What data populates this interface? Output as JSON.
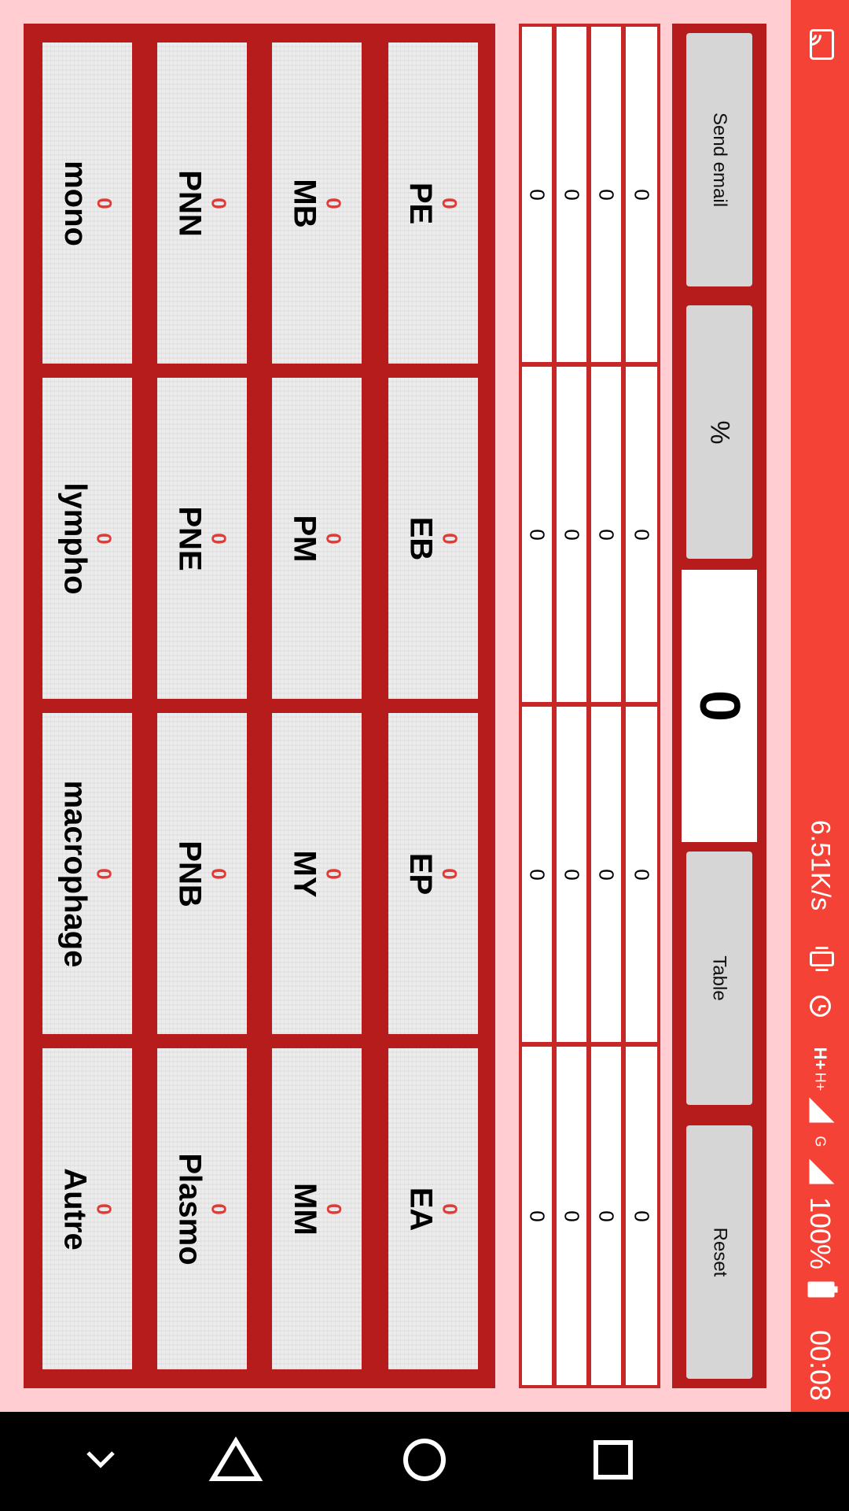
{
  "status_bar": {
    "net_speed": "6.51K/s",
    "network_primary": "H+",
    "network_secondary": "H+",
    "network_tertiary": "G",
    "battery": "100%",
    "time": "00:08",
    "icons": [
      "cast-icon",
      "vibrate-icon",
      "alarm-icon",
      "signal-icon",
      "signal-icon",
      "battery-icon"
    ]
  },
  "controls": {
    "send_email": "Send email",
    "percent": "%",
    "counter": "0",
    "table": "Table",
    "reset": "Reset"
  },
  "table": {
    "rows": [
      [
        "0",
        "0",
        "0",
        "0"
      ],
      [
        "0",
        "0",
        "0",
        "0"
      ],
      [
        "0",
        "0",
        "0",
        "0"
      ],
      [
        "0",
        "0",
        "0",
        "0"
      ]
    ]
  },
  "grid": {
    "rows": [
      [
        {
          "label": "PE",
          "count": "0"
        },
        {
          "label": "EB",
          "count": "0"
        },
        {
          "label": "EP",
          "count": "0"
        },
        {
          "label": "EA",
          "count": "0"
        }
      ],
      [
        {
          "label": "MB",
          "count": "0"
        },
        {
          "label": "PM",
          "count": "0"
        },
        {
          "label": "MY",
          "count": "0"
        },
        {
          "label": "MM",
          "count": "0"
        }
      ],
      [
        {
          "label": "PNN",
          "count": "0"
        },
        {
          "label": "PNE",
          "count": "0"
        },
        {
          "label": "PNB",
          "count": "0"
        },
        {
          "label": "Plasmo",
          "count": "0"
        }
      ],
      [
        {
          "label": "mono",
          "count": "0"
        },
        {
          "label": "lympho",
          "count": "0"
        },
        {
          "label": "macrophage",
          "count": "0"
        },
        {
          "label": "Autre",
          "count": "0"
        }
      ]
    ]
  },
  "nav": {
    "icons": [
      "chevron-down-icon",
      "back-triangle-icon",
      "home-circle-icon",
      "recents-square-icon"
    ]
  },
  "colors": {
    "accent": "#f44336",
    "panel": "#b71c1c",
    "background": "#ffcdd2",
    "count": "#e53935"
  }
}
